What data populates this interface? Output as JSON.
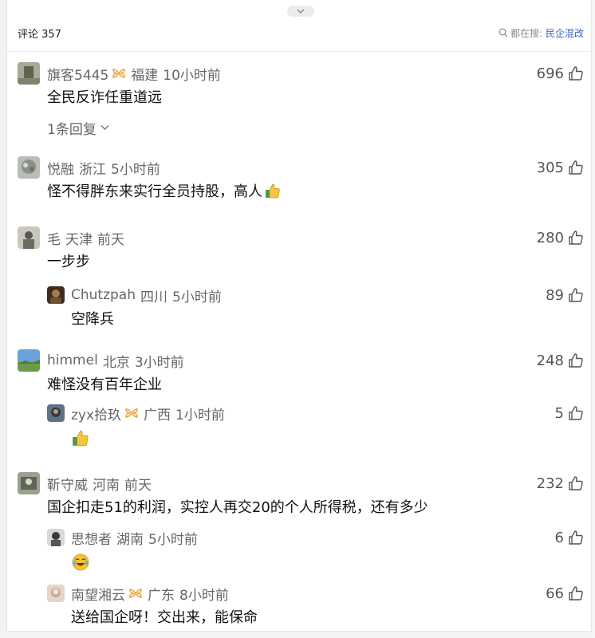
{
  "header": {
    "comment_count_label": "评论 357",
    "search_prefix": "都在搜:",
    "search_keyword": "民企混改"
  },
  "comments": [
    {
      "name": "旗客5445",
      "region": "福建",
      "time": "10小时前",
      "likes": "696",
      "text": "全民反诈任重道远",
      "more_replies": "1条回复",
      "avatar_color": "#8a8f7a"
    },
    {
      "name": "悦融",
      "region": "浙江",
      "time": "5小时前",
      "likes": "305",
      "text": "怪不得胖东来实行全员持股，高人",
      "avatar_color": "#9aa19a"
    },
    {
      "name": "毛",
      "region": "天津",
      "time": "前天",
      "likes": "280",
      "text": "一步步",
      "avatar_color": "#b0aea4",
      "reply": {
        "name": "Chutzpah",
        "region": "四川",
        "time": "5小时前",
        "likes": "89",
        "text": "空降兵",
        "avatar_color": "#6b5032"
      }
    },
    {
      "name": "himmel",
      "region": "北京",
      "time": "3小时前",
      "likes": "248",
      "text": "难怪没有百年企业",
      "avatar_color": "#5c8fc7",
      "reply": {
        "name": "zyx拾玖",
        "region": "广西",
        "time": "1小时前",
        "likes": "5",
        "avatar_color": "#4a5a6a"
      }
    },
    {
      "name": "靳守威",
      "region": "河南",
      "time": "前天",
      "likes": "232",
      "text": "国企扣走51的利润，实控人再交20的个人所得税，还有多少",
      "avatar_color": "#7a8070",
      "replies": [
        {
          "name": "思想者",
          "region": "湖南",
          "time": "5小时前",
          "likes": "6",
          "avatar_color": "#3a3a3a"
        },
        {
          "name": "南望湘云",
          "region": "广东",
          "time": "8小时前",
          "likes": "66",
          "text": "送给国企呀！交出来，能保命",
          "avatar_color": "#c9a898"
        }
      ]
    }
  ],
  "colors": {
    "accent": "#3a66c4",
    "badge": "#f0a33c",
    "meta": "#666666"
  },
  "icons": [
    "chevron-down-icon",
    "search-icon",
    "thumb-up-icon",
    "vip-badge-icon",
    "thumbs-up-emoji",
    "laughing-crying-emoji"
  ]
}
